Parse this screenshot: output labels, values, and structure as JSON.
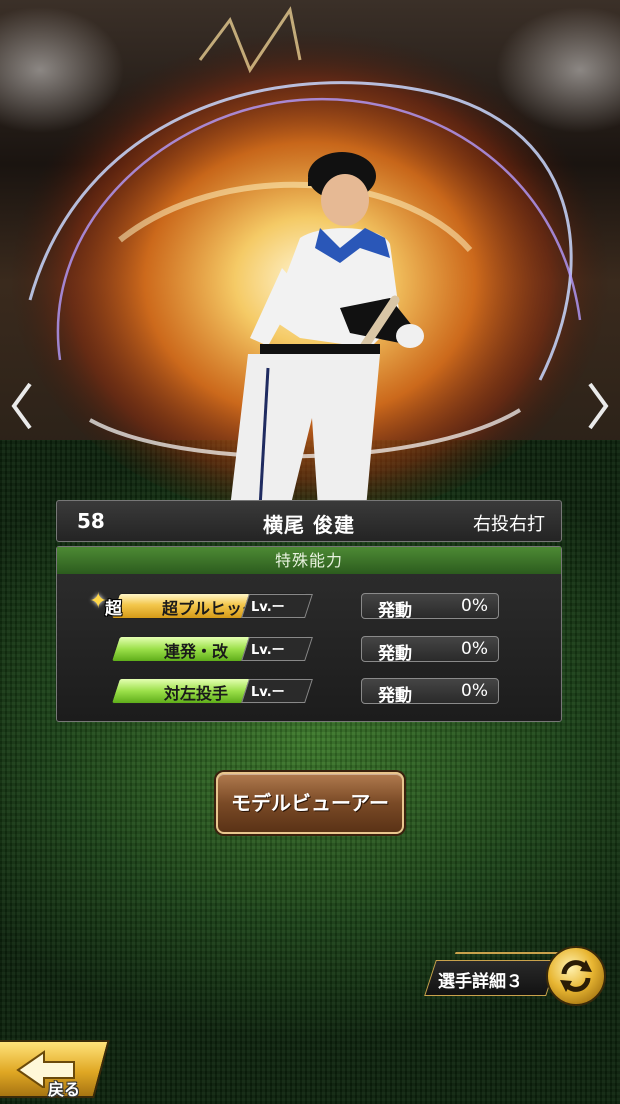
{
  "player": {
    "number": "58",
    "name": "横尾 俊建",
    "handedness": "右投右打"
  },
  "abilities_panel": {
    "title": "特殊能力",
    "items": [
      {
        "badge": "超",
        "name": "超プルヒッター",
        "level": "Lv.ー",
        "status": "発動",
        "rate": "0%",
        "style": "gold"
      },
      {
        "name": "連発・改",
        "level": "Lv.ー",
        "status": "発動",
        "rate": "0%",
        "style": "green"
      },
      {
        "name": "対左投手",
        "level": "Lv.ー",
        "status": "発動",
        "rate": "0%",
        "style": "green"
      }
    ]
  },
  "buttons": {
    "model_viewer": "モデルビューアー",
    "player_detail": "選手詳細３",
    "back": "戻る"
  },
  "icons": {
    "prev": "chevron-left-icon",
    "next": "chevron-right-icon",
    "cycle": "cycle-arrows-icon",
    "back": "back-arrow-icon",
    "sparkle": "sparkle-star-icon"
  },
  "colors": {
    "panel_header": "#3e7a2a",
    "gold_pill": "#f3c74c",
    "green_pill": "#9ce04a",
    "button_brown": "#7a4a26"
  }
}
